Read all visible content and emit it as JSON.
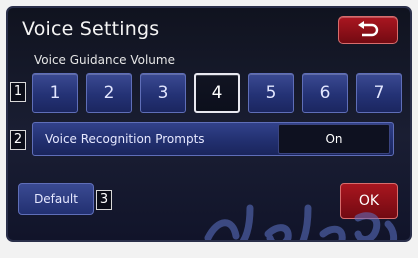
{
  "screen": {
    "title": "Voice Settings",
    "back_icon": "return-arrow-icon"
  },
  "voice_guidance": {
    "label": "Voice Guidance Volume",
    "row_number": "1",
    "levels": [
      "1",
      "2",
      "3",
      "4",
      "5",
      "6",
      "7"
    ],
    "selected": "4"
  },
  "voice_recognition": {
    "row_number": "2",
    "label": "Voice Recognition Prompts",
    "value": "On"
  },
  "footer": {
    "default_label": "Default",
    "default_number": "3",
    "ok_label": "OK"
  },
  "colors": {
    "accent_red": "#a9161f",
    "button_blue": "#2a3a80",
    "background": "#11142a"
  }
}
